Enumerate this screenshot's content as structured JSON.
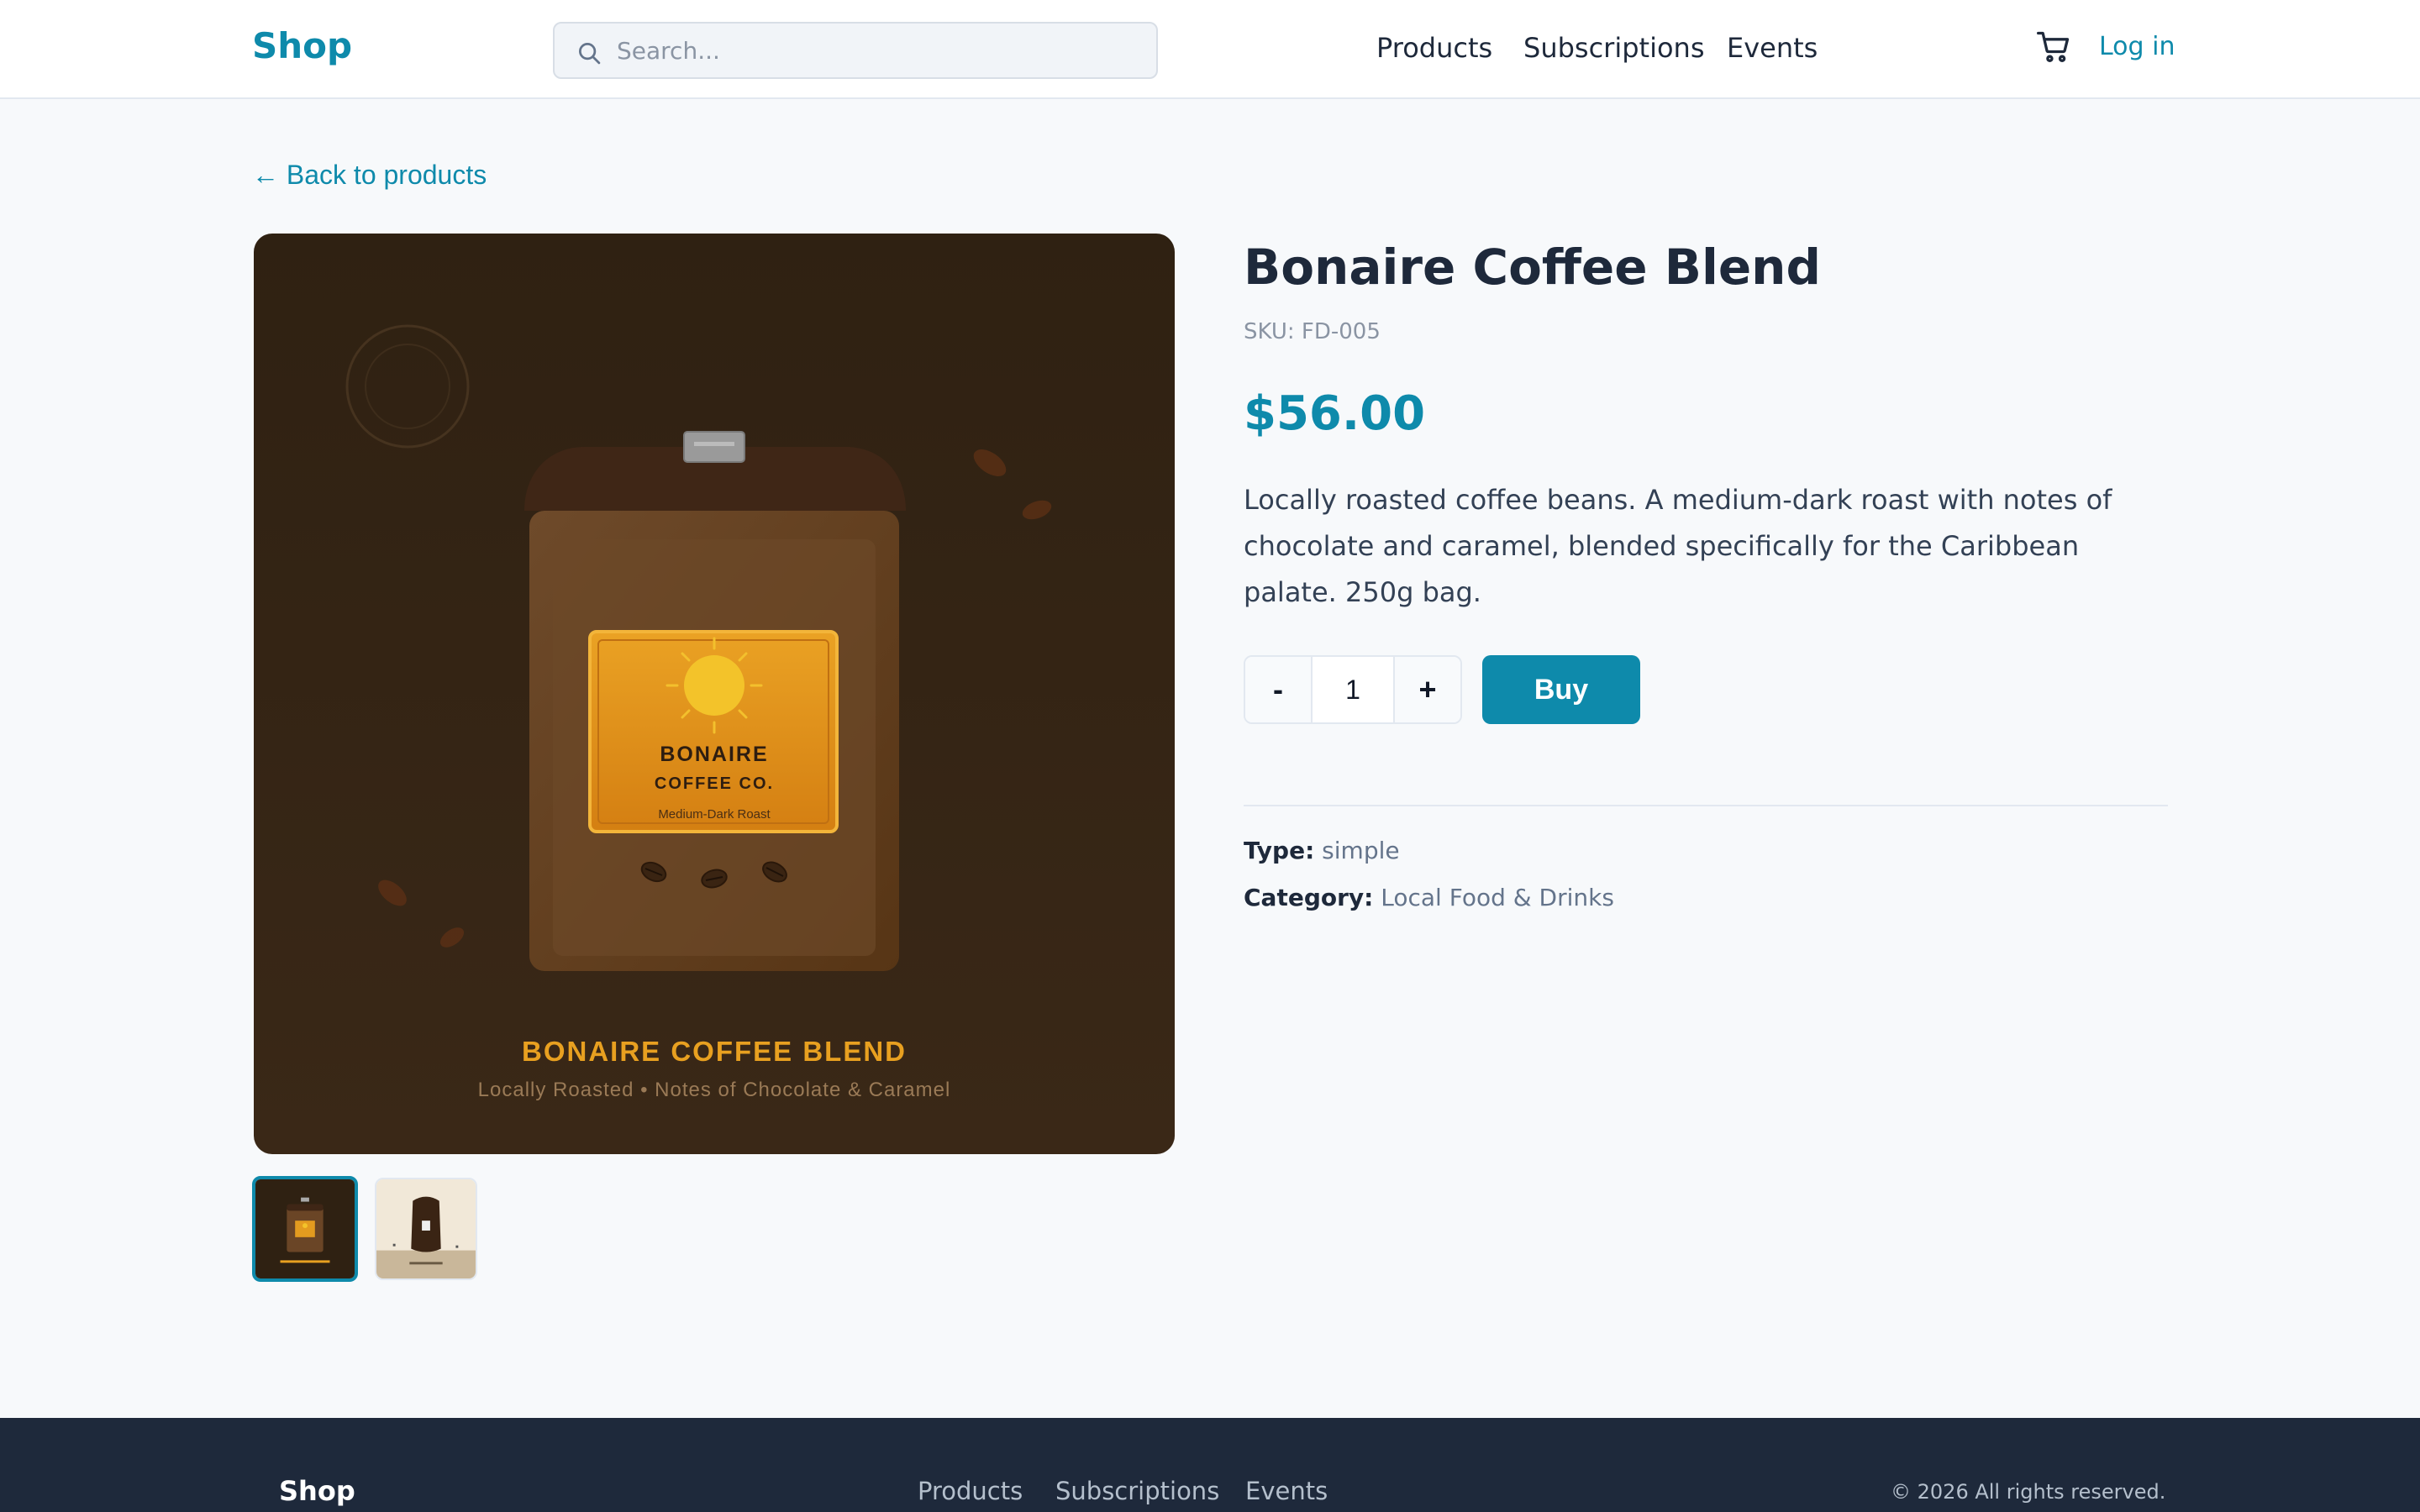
{
  "header": {
    "logo": "Shop",
    "search_placeholder": "Search...",
    "nav": [
      "Products",
      "Subscriptions",
      "Events"
    ],
    "cart_icon": "cart-icon",
    "login": "Log in"
  },
  "back_link": "← Back to products",
  "product": {
    "title": "Bonaire Coffee Blend",
    "sku": "SKU: FD-005",
    "price": "$56.00",
    "description": "Locally roasted coffee beans. A medium-dark roast with notes of chocolate and caramel, blended specifically for the Caribbean palate. 250g bag.",
    "quantity": "1",
    "minus_label": "-",
    "plus_label": "+",
    "buy_label": "Buy",
    "type_label": "Type:",
    "type_value": "simple",
    "category_label": "Category:",
    "category_value": "Local Food & Drinks"
  },
  "image": {
    "label_line1": "BONAIRE",
    "label_line2": "COFFEE CO.",
    "label_line3": "Medium-Dark Roast",
    "caption_title": "BONAIRE COFFEE BLEND",
    "caption_subtitle": "Locally Roasted • Notes of Chocolate & Caramel"
  },
  "colors": {
    "accent": "#0e8aab",
    "footer_bg": "#1e293b",
    "image_bg": "#2e2014",
    "label_gold": "#e8a020"
  },
  "footer": {
    "logo": "Shop",
    "links": [
      "Products",
      "Subscriptions",
      "Events"
    ],
    "copyright": "© 2026 All rights reserved."
  }
}
